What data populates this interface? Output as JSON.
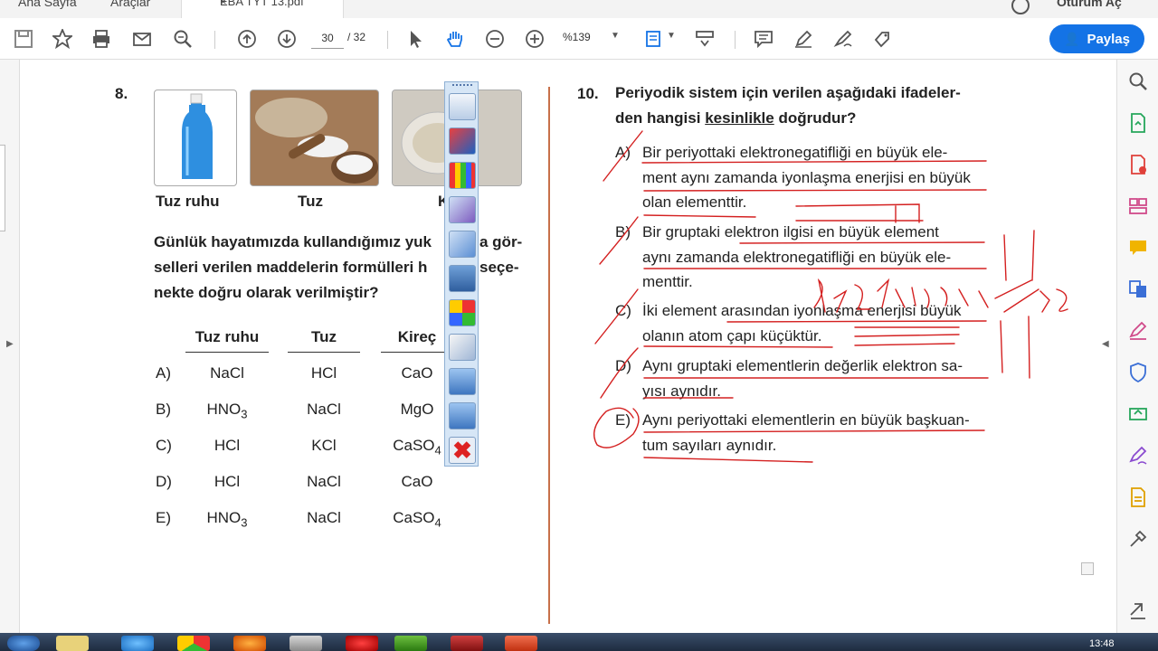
{
  "menu": {
    "home": "Ana Sayfa",
    "tools": "Araçlar",
    "doc_tab": "EBA TYT 13.pdf",
    "doc_close": "×",
    "signin": "Oturum Aç"
  },
  "toolbar": {
    "page_current": "30",
    "page_total": "/ 32",
    "zoom": "%139",
    "share_label": "Paylaş"
  },
  "q8": {
    "number": "8.",
    "images": [
      {
        "caption": "Tuz ruhu"
      },
      {
        "caption": "Tuz"
      },
      {
        "caption": "K"
      }
    ],
    "text": [
      "Günlük hayatımızda kullandığımız yuk",
      "a gör-",
      "selleri verilen maddelerin formülleri h",
      "seçe-",
      "nekte doğru olarak verilmiştir?"
    ],
    "columns": [
      "Tuz ruhu",
      "Tuz",
      "Kireç"
    ],
    "options": [
      {
        "letter": "A)",
        "c1": "NaCl",
        "c2": "HCl",
        "c3": "CaO",
        "c1_sub": "",
        "c3_sub": ""
      },
      {
        "letter": "B)",
        "c1": "HNO",
        "c2": "NaCl",
        "c3": "MgO",
        "c1_sub": "3",
        "c3_sub": ""
      },
      {
        "letter": "C)",
        "c1": "HCl",
        "c2": "KCl",
        "c3": "CaSO",
        "c1_sub": "",
        "c3_sub": "4"
      },
      {
        "letter": "D)",
        "c1": "HCl",
        "c2": "NaCl",
        "c3": "CaO",
        "c1_sub": "",
        "c3_sub": ""
      },
      {
        "letter": "E)",
        "c1": "HNO",
        "c2": "NaCl",
        "c3": "CaSO",
        "c1_sub": "3",
        "c3_sub": "4"
      }
    ]
  },
  "q10": {
    "number": "10.",
    "stem_line1": "Periyodik sistem için verilen aşağıdaki ifadeler-",
    "stem_line2_a": "den hangisi ",
    "stem_line2_b": "kesinlikle",
    "stem_line2_c": " doğrudur?",
    "options": [
      {
        "letter": "A)",
        "lines": [
          "Bir periyottaki elektronegatifliği en büyük ele-",
          "ment aynı zamanda iyonlaşma enerjisi en büyük",
          "olan elementtir."
        ]
      },
      {
        "letter": "B)",
        "lines": [
          "Bir gruptaki elektron ilgisi en büyük element",
          "aynı zamanda elektronegatifliği en büyük ele-",
          "menttir."
        ]
      },
      {
        "letter": "C)",
        "lines": [
          "İki element arasından iyonlaşma enerjisi büyük",
          "olanın atom çapı küçüktür."
        ]
      },
      {
        "letter": "D)",
        "lines": [
          "Aynı gruptaki elementlerin değerlik elektron sa-",
          "yısı aynıdır."
        ]
      },
      {
        "letter": "E)",
        "lines": [
          "Aynı periyottaki elementlerin en büyük başkuan-",
          "tum sayıları aynıdır."
        ]
      }
    ]
  },
  "taskbar": {
    "clock": "13:48"
  },
  "colors": {
    "accent": "#1473e6",
    "ink": "#d42020",
    "divider": "#c8704a"
  }
}
